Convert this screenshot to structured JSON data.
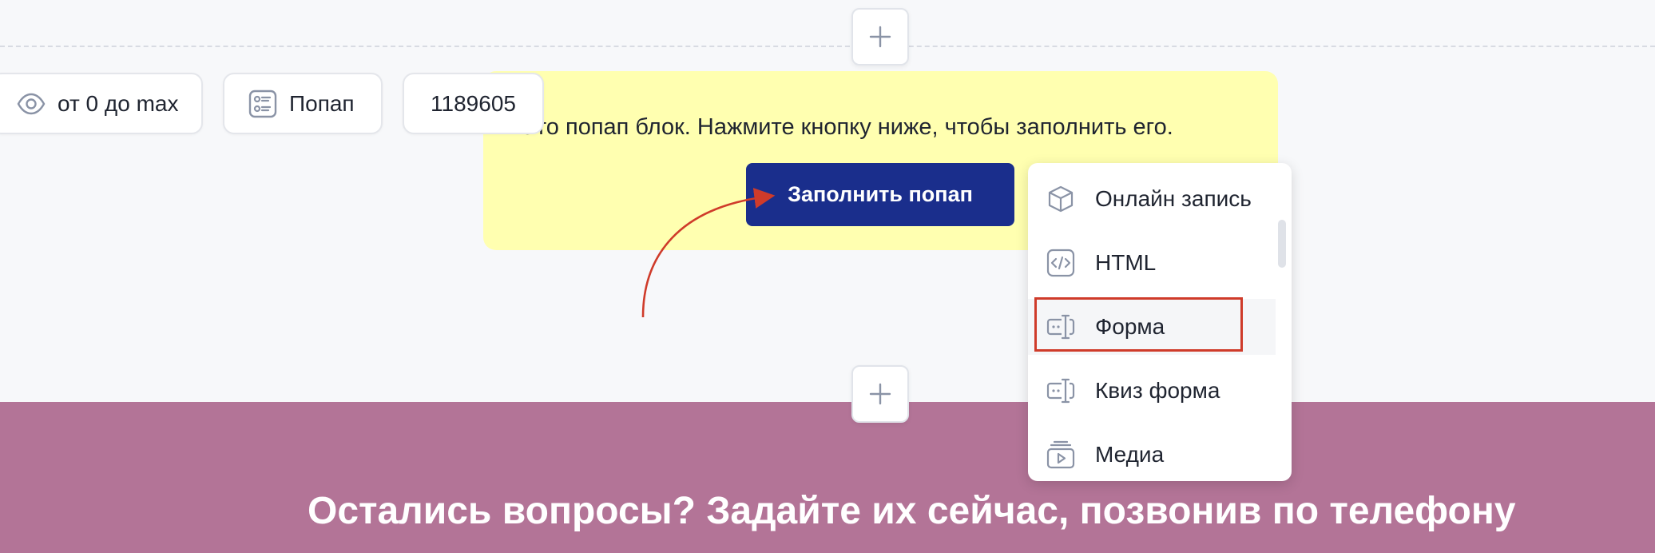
{
  "toolbar": {
    "visibility_label": "от 0 до max",
    "type_label": "Попап",
    "block_id": "1189605"
  },
  "popup": {
    "text": "Это попап блок. Нажмите кнопку ниже, чтобы заполнить его.",
    "fill_button": "Заполнить попап"
  },
  "menu": {
    "items": [
      {
        "label": "Онлайн запись",
        "icon": "cube-icon"
      },
      {
        "label": "HTML",
        "icon": "code-icon"
      },
      {
        "label": "Форма",
        "icon": "form-input-icon"
      },
      {
        "label": "Квиз форма",
        "icon": "quiz-form-icon"
      },
      {
        "label": "Медиа",
        "icon": "media-icon"
      }
    ],
    "highlighted_item": "Форма"
  },
  "footer": {
    "title": "Остались вопросы? Задайте их сейчас, позвонив по телефону"
  },
  "colors": {
    "popup_background": "#ffffb0",
    "primary_button": "#1a2e8c",
    "footer_band": "#b37497",
    "annotation_red": "#cf3b2a"
  }
}
